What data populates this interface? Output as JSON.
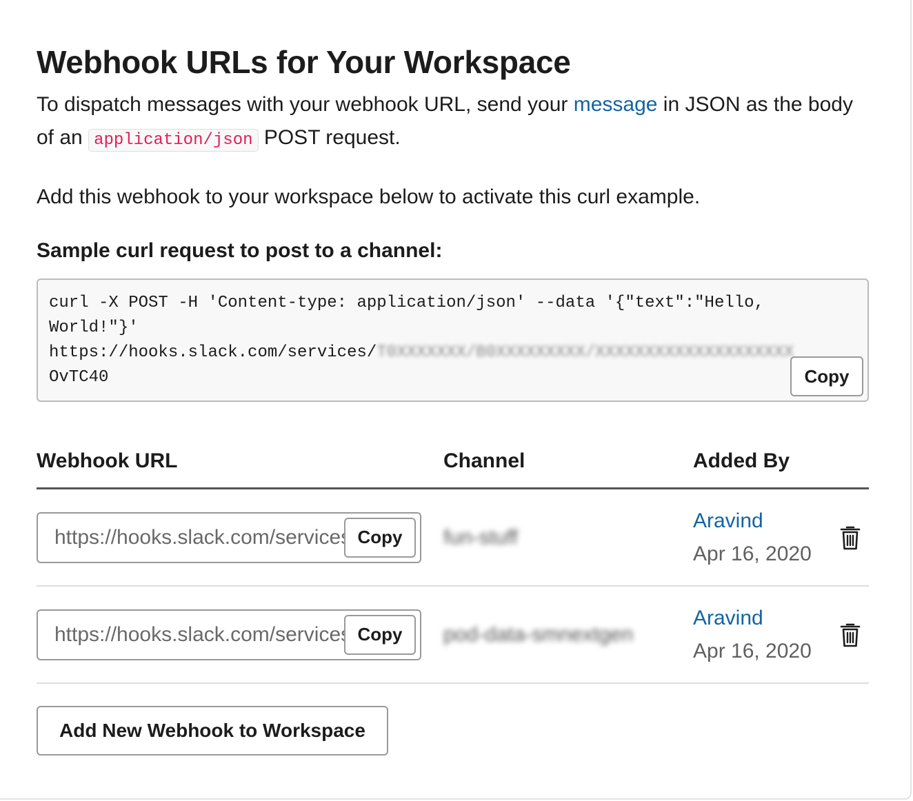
{
  "title": "Webhook URLs for Your Workspace",
  "intro": {
    "before_link": "To dispatch messages with your webhook URL, send your ",
    "link_text": "message",
    "after_link": " in JSON as the body of an ",
    "code": "application/json",
    "after_code": " POST request."
  },
  "activate_text": "Add this webhook to your workspace below to activate this curl example.",
  "sample": {
    "label": "Sample curl request to post to a channel:",
    "code_visible": "curl -X POST -H 'Content-type: application/json' --data '{\"text\":\"Hello, World!\"}' https://hooks.slack.com/services/",
    "code_hidden": "T0XXXXXXX/B0XXXXXXXXX/XXXXXXXXXXXXXXXXXXXX",
    "code_end": "OvTC40",
    "copy_label": "Copy"
  },
  "table": {
    "headers": {
      "url": "Webhook URL",
      "channel": "Channel",
      "added_by": "Added By"
    },
    "rows": [
      {
        "url": "https://hooks.slack.com/services/",
        "copy_label": "Copy",
        "channel": "fun-stuff",
        "added_by": "Aravind",
        "date": "Apr 16, 2020"
      },
      {
        "url": "https://hooks.slack.com/services/",
        "copy_label": "Copy",
        "channel": "pod-data-smnextgen",
        "added_by": "Aravind",
        "date": "Apr 16, 2020"
      }
    ]
  },
  "add_button": "Add New Webhook to Workspace",
  "colors": {
    "link": "#1264a3",
    "code": "#e01e5a",
    "text": "#1d1c1d",
    "muted": "#616061"
  },
  "icons": {
    "delete": "trash-icon"
  }
}
